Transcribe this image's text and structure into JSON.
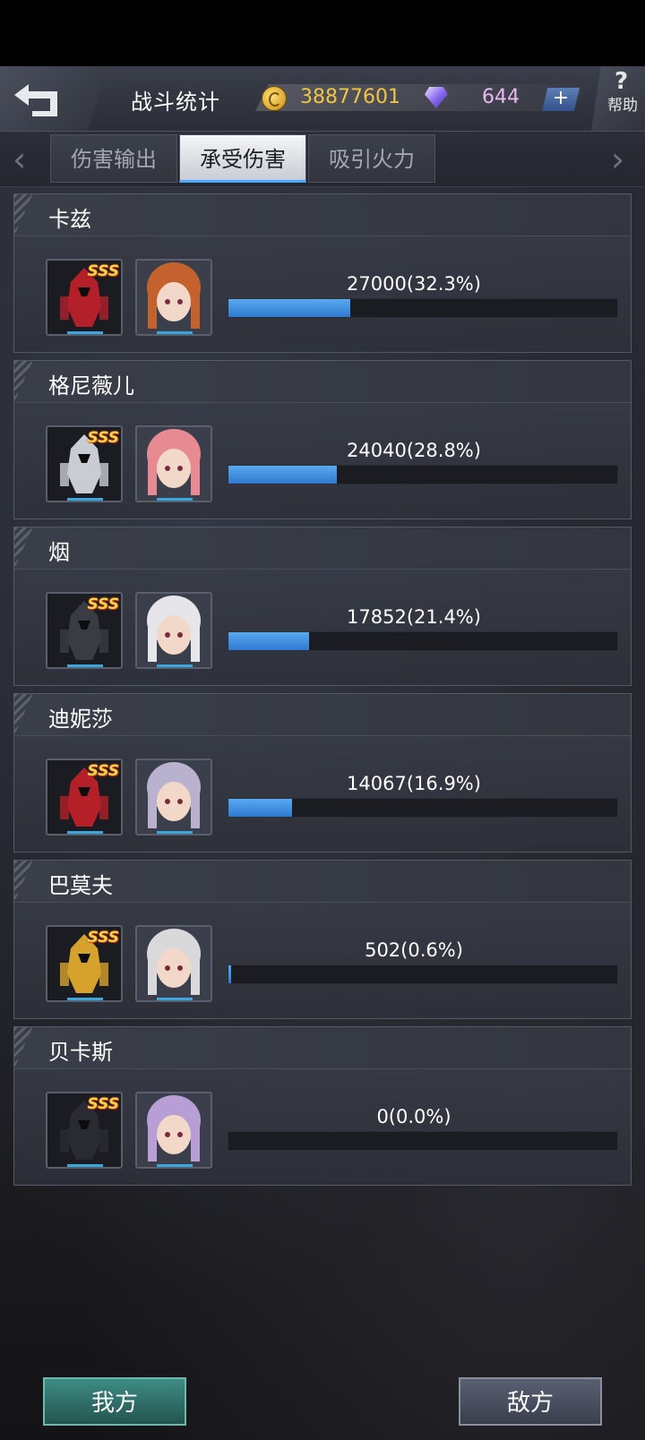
{
  "header": {
    "title": "战斗统计",
    "coins": "38877601",
    "gems": "644",
    "plus_label": "+",
    "help_label": "帮助"
  },
  "tabs": [
    {
      "label": "伤害输出",
      "active": false
    },
    {
      "label": "承受伤害",
      "active": true
    },
    {
      "label": "吸引火力",
      "active": false
    }
  ],
  "rows": [
    {
      "name": "卡兹",
      "value_label": "27000(32.3%)",
      "percent": 32.3,
      "rank": "SSS",
      "mech_color": "#b3202a",
      "pilot_color": "#c4622e"
    },
    {
      "name": "格尼薇儿",
      "value_label": "24040(28.8%)",
      "percent": 28.8,
      "rank": "SSS",
      "mech_color": "#c9ccd2",
      "pilot_color": "#e88a92"
    },
    {
      "name": "烟",
      "value_label": "17852(21.4%)",
      "percent": 21.4,
      "rank": "SSS",
      "mech_color": "#3a3c44",
      "pilot_color": "#e6e6ea"
    },
    {
      "name": "迪妮莎",
      "value_label": "14067(16.9%)",
      "percent": 16.9,
      "rank": "SSS",
      "mech_color": "#b51f27",
      "pilot_color": "#b9b2cf"
    },
    {
      "name": "巴莫夫",
      "value_label": "502(0.6%)",
      "percent": 0.6,
      "rank": "SSS",
      "mech_color": "#d7a22b",
      "pilot_color": "#d9d9dc"
    },
    {
      "name": "贝卡斯",
      "value_label": "0(0.0%)",
      "percent": 0.0,
      "rank": "SSS",
      "mech_color": "#2a2a32",
      "pilot_color": "#b79fd6"
    }
  ],
  "bottom": {
    "mine_label": "我方",
    "enemy_label": "敌方"
  }
}
